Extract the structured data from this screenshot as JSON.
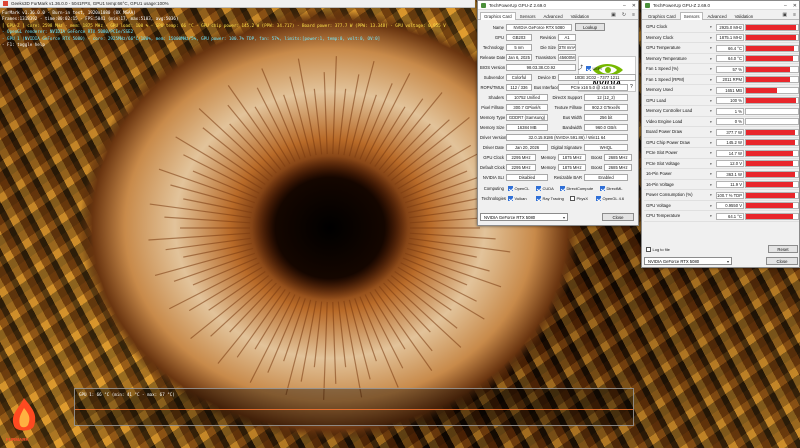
{
  "furmark": {
    "title": "Geeks3D FurMark v1.36.0.0 - 5041FPS, GPU1 temp:66°C, GPU1 usage:100%",
    "overlay": [
      {
        "text": "FurMark v1.36.0.0 - Burn-in test, 1920x1080 (8X MSAA)",
        "color": "white"
      },
      {
        "text": "Frames:1318392 - time:00:02:15 - FPS:5041 (min:17, max:5103, avg:5036)",
        "color": "white"
      },
      {
        "text": "[ GPU-Z ] core: 2598 MHz - mem: 1875 MHz - GPU load: 100 % - GPU temp: 66 °C - GPU chip power: 145.2 W (PPW: 34.717) - Board power: 377.7 W (PPW: 13.348) - GPU voltage: 0.955 V",
        "color": "yellow"
      },
      {
        "text": "- OpenGL renderer: NVIDIA GeForce RTX 5080/PCIe/SSE2",
        "color": "cyan"
      },
      {
        "text": "- GPU 1 (NVIDIA GeForce RTX 5080) - core: 2925MHz/66°C/100%, mem: 15000MHz/5%, GPU power: 100.7% TDP, fan: 57%, limits:[power:1, temp:0, volt:0, OV:0]",
        "color": "cyan"
      },
      {
        "text": "- F1: toggle help",
        "color": "white"
      }
    ],
    "graph_label": "GPU 1: 66 °C (min: 41 °C - max: 67 °C)",
    "logo_text": "FURMARK"
  },
  "gpuz_card": {
    "title": "TechPowerUp GPU-Z 2.69.0",
    "tabs": [
      "Graphics Card",
      "Sensors",
      "Advanced",
      "Validation"
    ],
    "active_tab": "Graphics Card",
    "name_label": "Name",
    "name_value": "NVIDIA GeForce RTX 5080",
    "lookup_label": "Lookup",
    "gpu_label": "GPU",
    "gpu_value": "GB203",
    "revision_label": "Revision",
    "revision_value": "A1",
    "technology_label": "Technology",
    "technology_value": "5 nm",
    "die_size_label": "Die Size",
    "die_size_value": "378 mm²",
    "release_date_label": "Release Date",
    "release_date_value": "Jan 6, 2025",
    "transistors_label": "Transistors",
    "transistors_value": "45600M",
    "bios_label": "BIOS Version",
    "bios_value": "98.03.38.C0.92",
    "uefi_label": "UEFI",
    "subvendor_label": "Subvendor",
    "subvendor_value": "Colorful",
    "device_id_label": "Device ID",
    "device_id_value": "10DE 2C02 - 7377 1211",
    "rops_label": "ROPs/TMUs",
    "rops_value": "112 / 336",
    "bus_label": "Bus Interface",
    "bus_value": "PCIe x16 5.0 @ x16 5.0",
    "shaders_label": "Shaders",
    "shaders_value": "10752 Unified",
    "directx_label": "DirectX Support",
    "directx_value": "12 (12_2)",
    "pixel_fillrate_label": "Pixel Fillrate",
    "pixel_fillrate_value": "300.7 GPixel/s",
    "texture_fillrate_label": "Texture Fillrate",
    "texture_fillrate_value": "902.2 GTexel/s",
    "memory_type_label": "Memory Type",
    "memory_type_value": "GDDR7 (Samsung)",
    "bus_width_label": "Bus Width",
    "bus_width_value": "256 bit",
    "memory_size_label": "Memory Size",
    "memory_size_value": "16384 MB",
    "bandwidth_label": "Bandwidth",
    "bandwidth_value": "960.0 GB/s",
    "driver_version_label": "Driver Version",
    "driver_version_value": "32.0.15.9186 (NVIDIA 591.86) / Win11 64",
    "driver_date_label": "Driver Date",
    "driver_date_value": "Jan 20, 2026",
    "digital_sig_label": "Digital Signature",
    "digital_sig_value": "WHQL",
    "gpu_clock_label": "GPU Clock",
    "gpu_clock_value": "2295 MHz",
    "memory_label": "Memory",
    "memory_value": "1875 MHz",
    "boost_label": "Boost",
    "boost_value": "2685 MHz",
    "default_clock_label": "Default Clock",
    "default_clock_value": "2295 MHz",
    "default_memory_value": "1875 MHz",
    "default_boost_value": "2685 MHz",
    "sli_label": "NVIDIA SLI",
    "sli_value": "Disabled",
    "rebar_label": "Resizable BAR",
    "rebar_value": "Enabled",
    "computing_label": "Computing",
    "computing": [
      {
        "label": "OpenCL",
        "on": true
      },
      {
        "label": "CUDA",
        "on": true
      },
      {
        "label": "DirectCompute",
        "on": true
      },
      {
        "label": "DirectML",
        "on": true
      }
    ],
    "technologies_label": "Technologies",
    "technologies": [
      {
        "label": "Vulkan",
        "on": true
      },
      {
        "label": "Ray Tracing",
        "on": true
      },
      {
        "label": "PhysX",
        "on": false
      },
      {
        "label": "OpenGL 4.6",
        "on": true
      }
    ],
    "device_select": "NVIDIA GeForce RTX 5080",
    "close_label": "Close"
  },
  "gpuz_sensors": {
    "title": "TechPowerUp GPU-Z 2.69.0",
    "tabs": [
      "Graphics Card",
      "Sensors",
      "Advanced",
      "Validation"
    ],
    "active_tab": "Sensors",
    "sensors": [
      {
        "name": "GPU Clock",
        "value": "2925.0 MHz",
        "level": 0.97
      },
      {
        "name": "Memory Clock",
        "value": "1875.1 MHz",
        "level": 0.97
      },
      {
        "name": "GPU Temperature",
        "value": "66.4 °C",
        "level": 0.92
      },
      {
        "name": "Memory Temperature",
        "value": "64.0 °C",
        "level": 0.9
      },
      {
        "name": "Fan 1 Speed (%)",
        "value": "57 %",
        "level": 0.85
      },
      {
        "name": "Fan 1 Speed (RPM)",
        "value": "2011 RPM",
        "level": 0.85
      },
      {
        "name": "Memory Used",
        "value": "1651 MB",
        "level": 0.6
      },
      {
        "name": "GPU Load",
        "value": "100 %",
        "level": 0.97
      },
      {
        "name": "Memory Controller Load",
        "value": "1 %",
        "level": 0.0
      },
      {
        "name": "Video Engine Load",
        "value": "0 %",
        "level": 0.0
      },
      {
        "name": "Board Power Draw",
        "value": "377.7 W",
        "level": 0.95
      },
      {
        "name": "GPU Chip Power Draw",
        "value": "145.2 W",
        "level": 0.95
      },
      {
        "name": "PCIe Slot Power",
        "value": "14.7 W",
        "level": 0.9
      },
      {
        "name": "PCIe Slot Voltage",
        "value": "12.0 V",
        "level": 0.9
      },
      {
        "name": "16-Pin Power",
        "value": "363.1 W",
        "level": 0.95
      },
      {
        "name": "16-Pin Voltage",
        "value": "11.9 V",
        "level": 0.9
      },
      {
        "name": "Power Consumption (%)",
        "value": "100.7 % TDP",
        "level": 0.95
      },
      {
        "name": "GPU Voltage",
        "value": "0.9550 V",
        "level": 0.9
      },
      {
        "name": "CPU Temperature",
        "value": "64.1 °C",
        "level": 0.9
      }
    ],
    "log_label": "Log to file",
    "reset_label": "Reset",
    "device_select": "NVIDIA GeForce RTX 5080",
    "close_label": "Close"
  },
  "colors": {
    "sensor_fill": "#e8262b",
    "nvidia_green": "#76b900"
  }
}
